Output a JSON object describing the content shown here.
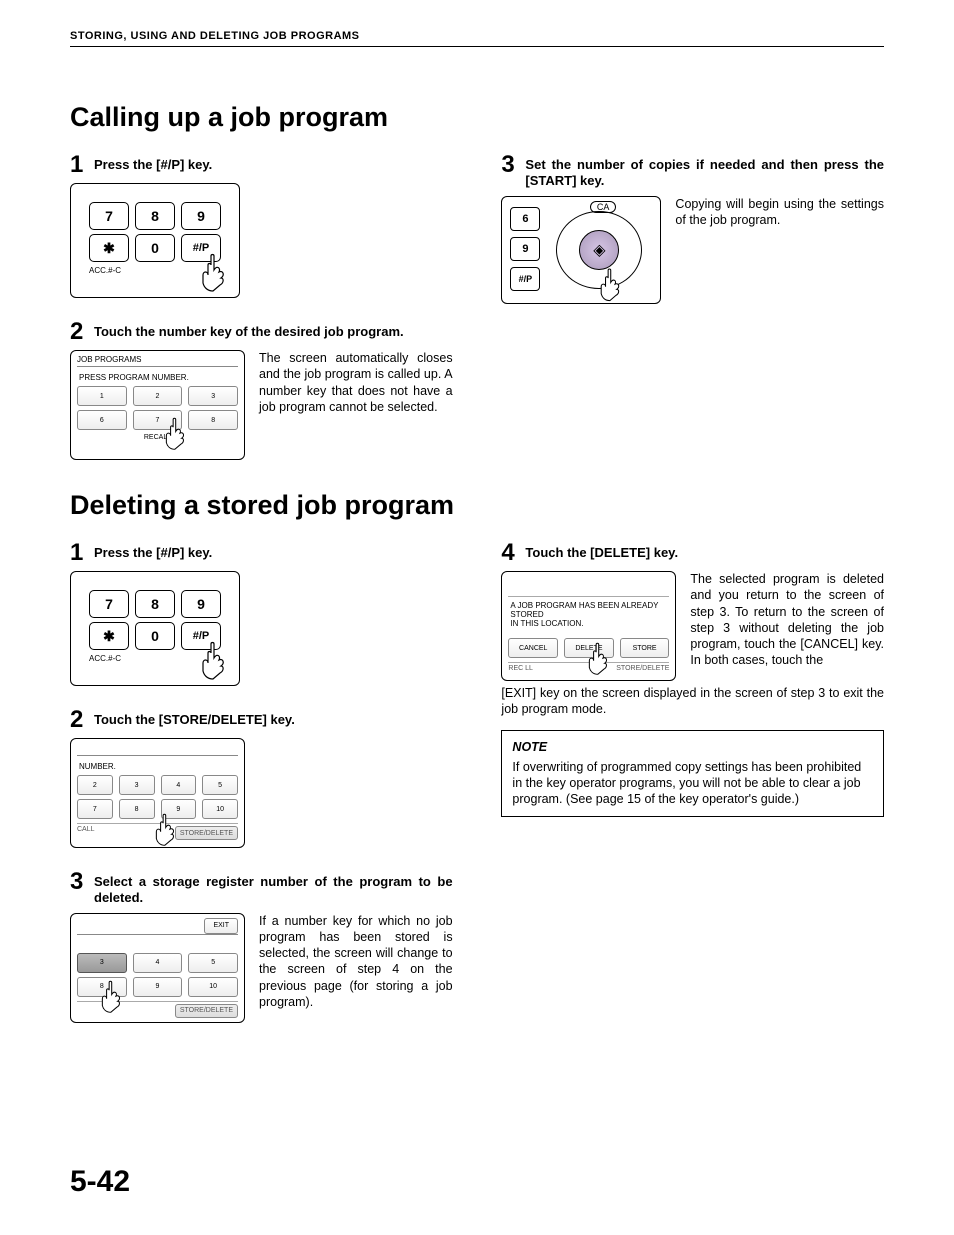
{
  "header": "STORING, USING AND DELETING JOB PROGRAMS",
  "page_number": "5-42",
  "s1": {
    "title": "Calling up a job program",
    "step1": {
      "num": "1",
      "title": "Press the [#/P] key."
    },
    "step2": {
      "num": "2",
      "title": "Touch the number key of the desired job program.",
      "desc": "The screen automatically closes and the job program is called up. A number key that does not have a job program cannot be selected."
    },
    "step3": {
      "num": "3",
      "title": "Set the number of copies if needed and then press the [START] key.",
      "desc": "Copying will begin using the settings of the job program."
    }
  },
  "s2": {
    "title": "Deleting a stored job program",
    "step1": {
      "num": "1",
      "title": "Press the [#/P] key."
    },
    "step2": {
      "num": "2",
      "title": "Touch the [STORE/DELETE] key."
    },
    "step3": {
      "num": "3",
      "title": "Select a storage register number of the program to be deleted.",
      "desc": "If a number key for which no job program has been stored is selected, the screen will change to the screen of step 4 on the previous page (for storing a job program)."
    },
    "step4": {
      "num": "4",
      "title": "Touch the [DELETE] key.",
      "desc": "The selected program is deleted and you return to the screen of step 3. To return to the screen of step 3 without deleting the job program, touch the [CANCEL] key. In both cases, touch the [EXIT] key on the screen displayed in the screen of step 3 to exit the job program mode."
    },
    "note_title": "NOTE",
    "note_body": "If overwriting of programmed copy settings has been prohibited in the key operator programs, you will not be able to clear a job program. (See page 15 of the key operator's guide.)"
  },
  "keypad": {
    "keys_row1": [
      "7",
      "8",
      "9"
    ],
    "keys_row2": [
      "✱",
      "0",
      "#/P"
    ],
    "acc_label": "ACC.#-C"
  },
  "start": {
    "keys": [
      "6",
      "9",
      "#/P"
    ],
    "ca": "CA"
  },
  "ts_jobprog": {
    "title": "JOB PROGRAMS",
    "msg": "PRESS PROGRAM NUMBER.",
    "row1": [
      "1",
      "2",
      "3"
    ],
    "row2": [
      "6",
      "7",
      "8"
    ],
    "recall": "RECALL"
  },
  "ts_number": {
    "msg": "NUMBER.",
    "row1": [
      "2",
      "3",
      "4",
      "5"
    ],
    "row2": [
      "7",
      "8",
      "9",
      "10"
    ],
    "left": "CALL",
    "right": "STORE/DELETE"
  },
  "ts_exit": {
    "exit": "EXIT",
    "row1": [
      "3",
      "4",
      "5"
    ],
    "row2": [
      "8",
      "9",
      "10"
    ],
    "right": "STORE/DELETE"
  },
  "ts_del": {
    "msg1": "A JOB PROGRAM HAS BEEN ALREADY STORED",
    "msg2": "IN THIS LOCATION.",
    "btns": [
      "CANCEL",
      "DELETE",
      "STORE"
    ],
    "left": "REC LL",
    "right": "STORE/DELETE"
  }
}
